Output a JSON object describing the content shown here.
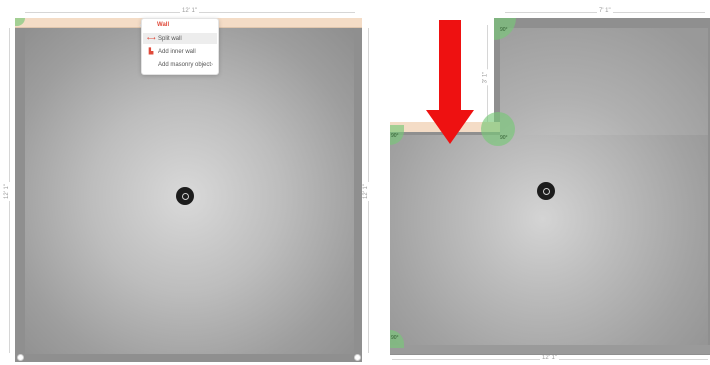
{
  "left_panel": {
    "top_dimension": "12' 1\"",
    "left_dimension": "12' 1\"",
    "right_dimension": "12' 1\""
  },
  "context_menu": {
    "title": "Wall",
    "items": [
      {
        "label": "Split wall",
        "icon": "split-icon",
        "highlighted": true
      },
      {
        "label": "Add inner wall",
        "icon": "inner-wall-icon",
        "highlighted": false
      },
      {
        "label": "Add masonry object",
        "icon": "",
        "has_submenu": true
      }
    ]
  },
  "right_panel": {
    "top_dimension": "7' 1\"",
    "left_dimension": "3' 1\"",
    "bottom_dimension": "12' 1\"",
    "handle_labels": [
      "90°",
      "90°",
      "90°",
      "90°"
    ]
  },
  "colors": {
    "selected_wall": "#f4dcc6",
    "menu_title": "#e04a3a",
    "arrow": "#ee1111",
    "handle": "#78c878"
  }
}
